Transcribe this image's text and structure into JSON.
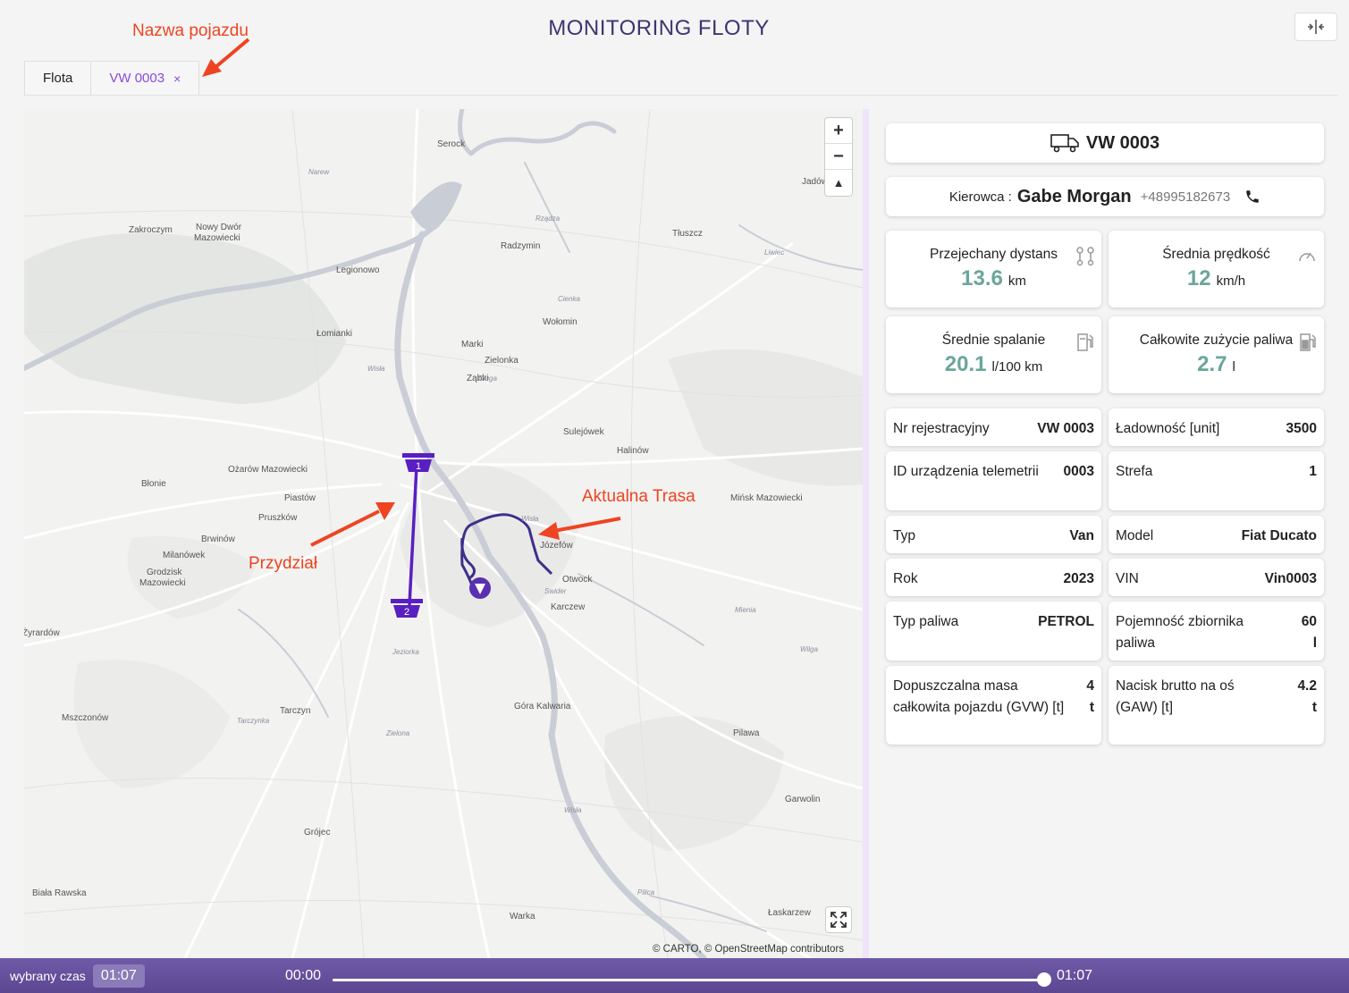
{
  "header": {
    "title": "MONITORING FLOTY",
    "collapse_icon": "split-columns-icon"
  },
  "annotations": {
    "vehicle_name": "Nazwa pojazdu",
    "assignment": "Przydział",
    "current_route": "Aktualna Trasa"
  },
  "tabs": [
    {
      "label": "Flota",
      "active": false
    },
    {
      "label": "VW 0003",
      "active": true,
      "close": "×"
    }
  ],
  "map": {
    "zoom_in": "+",
    "zoom_out": "−",
    "reset_bearing": "▲",
    "attribution": "© CARTO, © OpenStreetMap contributors",
    "markers": {
      "start": "1",
      "end": "2"
    },
    "places": [
      "Serock",
      "Jadów",
      "Zakroczym",
      "Nowy Dwór",
      "Mazowiecki",
      "Tłuszcz",
      "Radzymin",
      "Legionowo",
      "Wołomin",
      "Łomianki",
      "Marki",
      "Zielonka",
      "Ząbki",
      "Sulejówek",
      "Halinów",
      "Ożarów Mazowiecki",
      "Błonie",
      "Piastów",
      "Pruszków",
      "Mińsk Mazowiecki",
      "Józefów",
      "Brwinów",
      "Milanówek",
      "Grodzisk",
      "Mazowiecki",
      "Otwock",
      "Karczew",
      "Żyrardów",
      "Mszczonów",
      "Tarczyn",
      "Góra Kalwaria",
      "Pilawa",
      "Garwolin",
      "Grójec",
      "Biała Rawska",
      "Warka",
      "Łaskarzew"
    ],
    "rivers": [
      "Narew",
      "Rządza",
      "Cienka",
      "Wisła",
      "Liwiec",
      "Długa",
      "Wisła",
      "Jeziorka",
      "Tarczynka",
      "Wisła",
      "Swider",
      "Wilga",
      "Zielona",
      "Pilica",
      "Mienia"
    ]
  },
  "vehicle": {
    "name": "VW 0003",
    "icon": "truck-icon"
  },
  "driver": {
    "label": "Kierowca :",
    "name": "Gabe Morgan",
    "phone": "+48995182673",
    "icon": "phone-icon"
  },
  "stats": [
    {
      "label": "Przejechany dystans",
      "value": "13.6",
      "unit": "km",
      "icon": "route-icon"
    },
    {
      "label": "Średnia prędkość",
      "value": "12",
      "unit": "km/h",
      "icon": "speedometer-icon"
    },
    {
      "label": "Średnie spalanie",
      "value": "20.1",
      "unit": "l/100 km",
      "icon": "fuel-pump-icon"
    },
    {
      "label": "Całkowite zużycie paliwa",
      "value": "2.7",
      "unit": "l",
      "icon": "fuel-icon"
    }
  ],
  "details": [
    {
      "key": "Nr rejestracyjny",
      "value": "VW 0003"
    },
    {
      "key": "Ładowność [unit]",
      "value": "3500"
    },
    {
      "key": "ID urządzenia telemetrii",
      "value": "0003"
    },
    {
      "key": "Strefa",
      "value": "1"
    },
    {
      "key": "Typ",
      "value": "Van"
    },
    {
      "key": "Model",
      "value": "Fiat Ducato"
    },
    {
      "key": "Rok",
      "value": "2023"
    },
    {
      "key": "VIN",
      "value": "Vin0003"
    },
    {
      "key": "Typ paliwa",
      "value": "PETROL"
    },
    {
      "key": "Pojemność zbiornika paliwa",
      "value": "60 l"
    },
    {
      "key": "Dopuszczalna masa całkowita pojazdu (GVW) [t]",
      "value": "4 t"
    },
    {
      "key": "Nacisk brutto na oś (GAW) [t]",
      "value": "4.2 t"
    }
  ],
  "timebar": {
    "label": "wybrany czas",
    "selected": "01:07",
    "start": "00:00",
    "end": "01:07",
    "progress": 1.0
  },
  "colors": {
    "accent": "#8a4be0",
    "stat_value": "#6aa69a",
    "route": "#3d2f8a",
    "assignment_line": "#5a1fc2",
    "annotation": "#ee4422",
    "timebar": "#5c4791"
  }
}
